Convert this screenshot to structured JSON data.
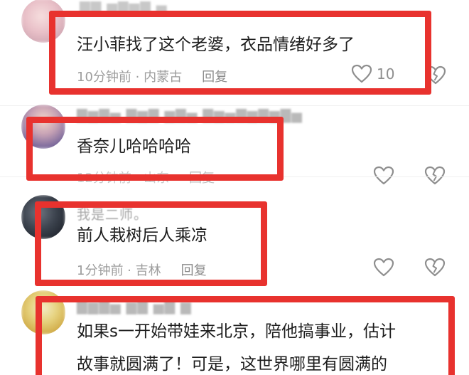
{
  "comments": [
    {
      "text": "汪小菲找了这个老婆，衣品情绪好多了",
      "time_location": "10分钟前 · 内蒙古",
      "reply_label": "回复",
      "like_count": "10"
    },
    {
      "text": "香奈儿哈哈哈哈",
      "time_location": "12分钟前 · 山东",
      "reply_label": "回复"
    },
    {
      "username": "我是二师。",
      "text": "前人栽树后人乘凉",
      "time_location": "1分钟前 · 吉林",
      "reply_label": "回复"
    },
    {
      "text_lines": [
        "如果s一开始带娃来北京，陪他搞事业，估计",
        "故事就圆满了！可是，这世界哪里有圆满的"
      ]
    }
  ],
  "colors": {
    "highlight": "#e8322e",
    "text": "#1d1d1d",
    "meta": "#9d9d9d"
  },
  "icons": [
    "heart-icon",
    "broken-heart-icon"
  ]
}
